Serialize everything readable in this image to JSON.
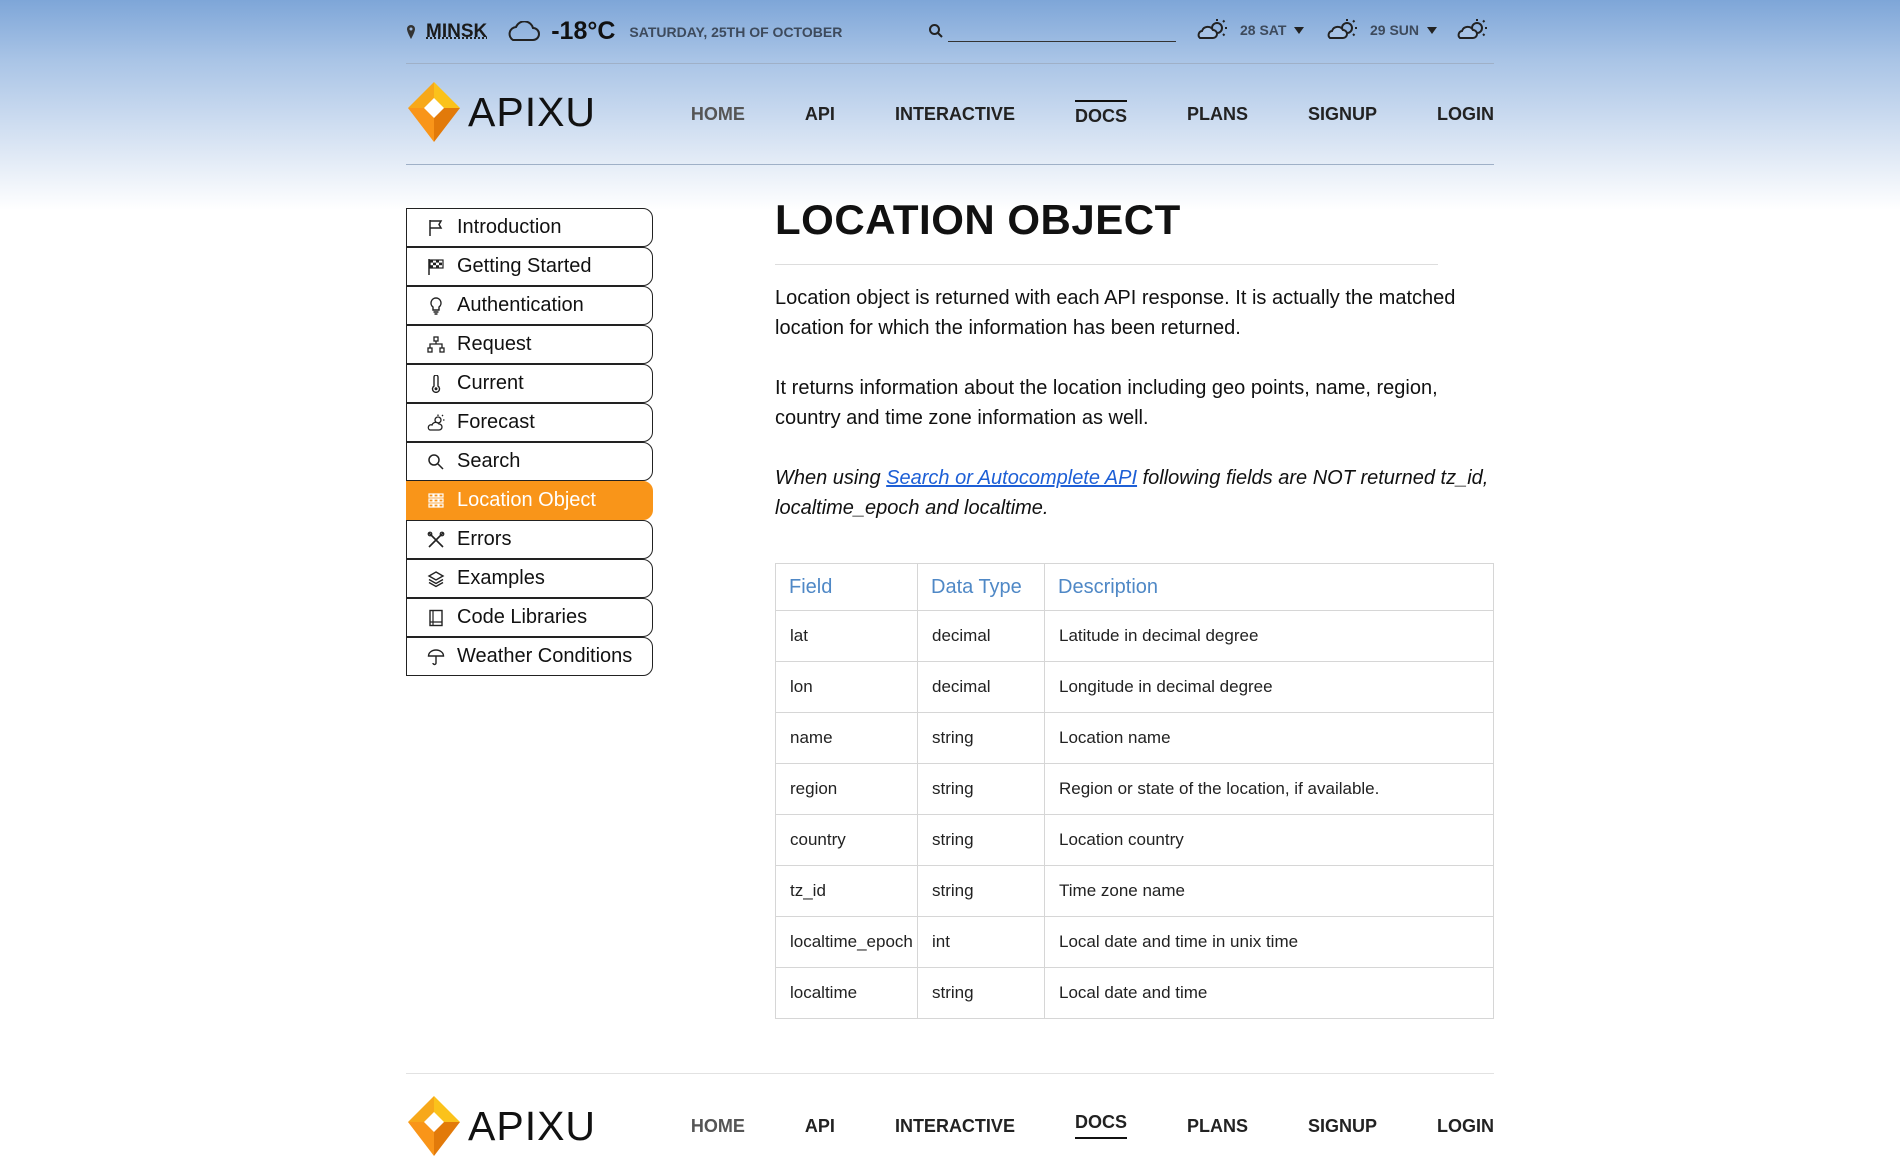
{
  "topbar": {
    "city": "MINSK",
    "temperature": "-18°C",
    "date": "SATURDAY, 25TH OF OCTOBER",
    "search_value": "",
    "forecast": [
      {
        "label": "28 SAT"
      },
      {
        "label": "29 SUN"
      }
    ]
  },
  "brand": {
    "name": "APIXU",
    "colors": {
      "orange": "#f99519",
      "dark_orange": "#e27a0a",
      "yellow": "#fbc21b"
    }
  },
  "nav": [
    "HOME",
    "API",
    "INTERACTIVE",
    "DOCS",
    "PLANS",
    "SIGNUP",
    "LOGIN"
  ],
  "nav_active": "DOCS",
  "sidebar": {
    "items": [
      {
        "label": "Introduction",
        "icon": "flag-icon"
      },
      {
        "label": "Getting Started",
        "icon": "checkered-flag-icon"
      },
      {
        "label": "Authentication",
        "icon": "lightbulb-icon"
      },
      {
        "label": "Request",
        "icon": "sitemap-icon"
      },
      {
        "label": "Current",
        "icon": "thermometer-icon"
      },
      {
        "label": "Forecast",
        "icon": "sun-cloud-icon"
      },
      {
        "label": "Search",
        "icon": "magnifier-icon"
      },
      {
        "label": "Location Object",
        "icon": "grid-icon"
      },
      {
        "label": "Errors",
        "icon": "cross-tools-icon"
      },
      {
        "label": "Examples",
        "icon": "layers-icon"
      },
      {
        "label": "Code Libraries",
        "icon": "book-icon"
      },
      {
        "label": "Weather Conditions",
        "icon": "umbrella-icon"
      }
    ],
    "active_index": 7,
    "active_color": "#f99519"
  },
  "main": {
    "title": "LOCATION OBJECT",
    "para1": "Location object is returned with each API response. It is actually the matched location for which the information has been returned.",
    "para2": "It returns information about the location including geo points, name, region, country and time zone information as well.",
    "para3_before": "When using ",
    "para3_link": "Search or Autocomplete API",
    "para3_after": " following fields are NOT returned tz_id, localtime_epoch and localtime.",
    "table": {
      "headers": [
        "Field",
        "Data Type",
        "Description"
      ],
      "rows": [
        [
          "lat",
          "decimal",
          "Latitude in decimal degree"
        ],
        [
          "lon",
          "decimal",
          "Longitude in decimal degree"
        ],
        [
          "name",
          "string",
          "Location name"
        ],
        [
          "region",
          "string",
          "Region or state of the location, if available."
        ],
        [
          "country",
          "string",
          "Location country"
        ],
        [
          "tz_id",
          "string",
          "Time zone name"
        ],
        [
          "localtime_epoch",
          "int",
          "Local date and time in unix time"
        ],
        [
          "localtime",
          "string",
          "Local date and time"
        ]
      ]
    }
  }
}
